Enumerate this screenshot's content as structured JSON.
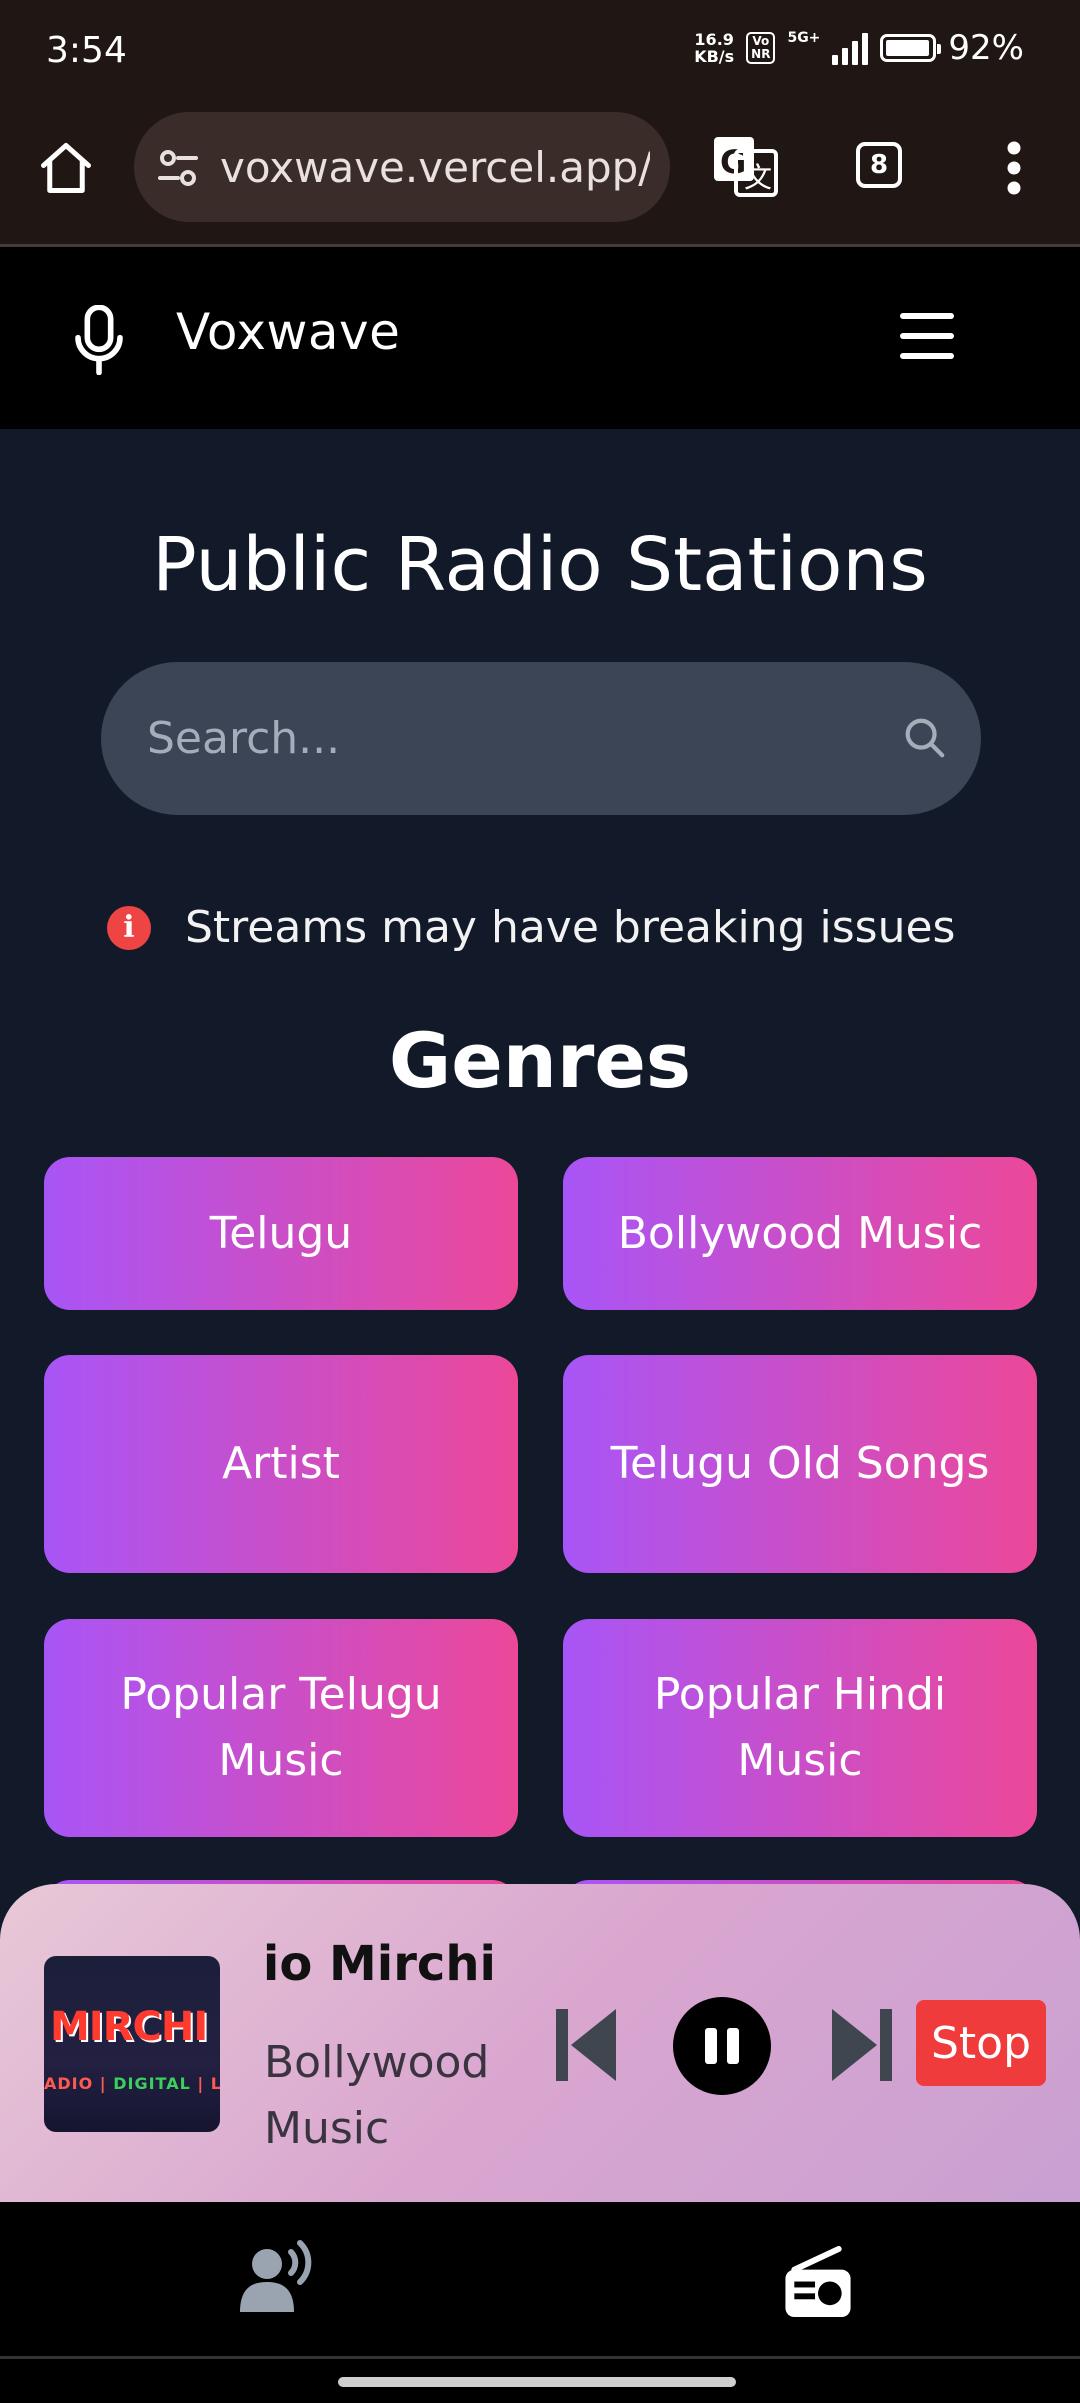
{
  "status_bar": {
    "time": "3:54",
    "speed_value": "16.9",
    "speed_unit": "KB/s",
    "vonr_top": "Vo",
    "vonr_bottom": "NR",
    "network": "5G+",
    "battery_pct": "92%"
  },
  "browser": {
    "url": "voxwave.vercel.app/ap",
    "tab_count": "8"
  },
  "app": {
    "brand": "Voxwave"
  },
  "main": {
    "title": "Public Radio Stations",
    "search_placeholder": "Search...",
    "notice": "Streams may have breaking issues",
    "genres_title": "Genres",
    "genres": [
      {
        "label": "Telugu"
      },
      {
        "label": "Bollywood Music"
      },
      {
        "label": "Artist"
      },
      {
        "label": "Telugu Old Songs"
      },
      {
        "label": "Popular Telugu Music"
      },
      {
        "label": "Popular Hindi Music"
      },
      {
        "label": ""
      },
      {
        "label": ""
      }
    ]
  },
  "player": {
    "station": "Radio Mirchi",
    "genre": "Bollywood Music",
    "album_logo": "MIRCHI",
    "album_tag1": "ADIO",
    "album_tag2": "DIGITAL",
    "album_tag3": "LI",
    "stop_label": "Stop"
  },
  "bottom_nav": {
    "items": [
      {
        "icon": "podcast-icon"
      },
      {
        "icon": "radio-icon"
      }
    ]
  },
  "colors": {
    "background": "#121a2a",
    "accent_gradient_start": "#a855f7",
    "accent_gradient_end": "#ec4899",
    "stop": "#ef3b3b",
    "warning": "#ef4444"
  }
}
